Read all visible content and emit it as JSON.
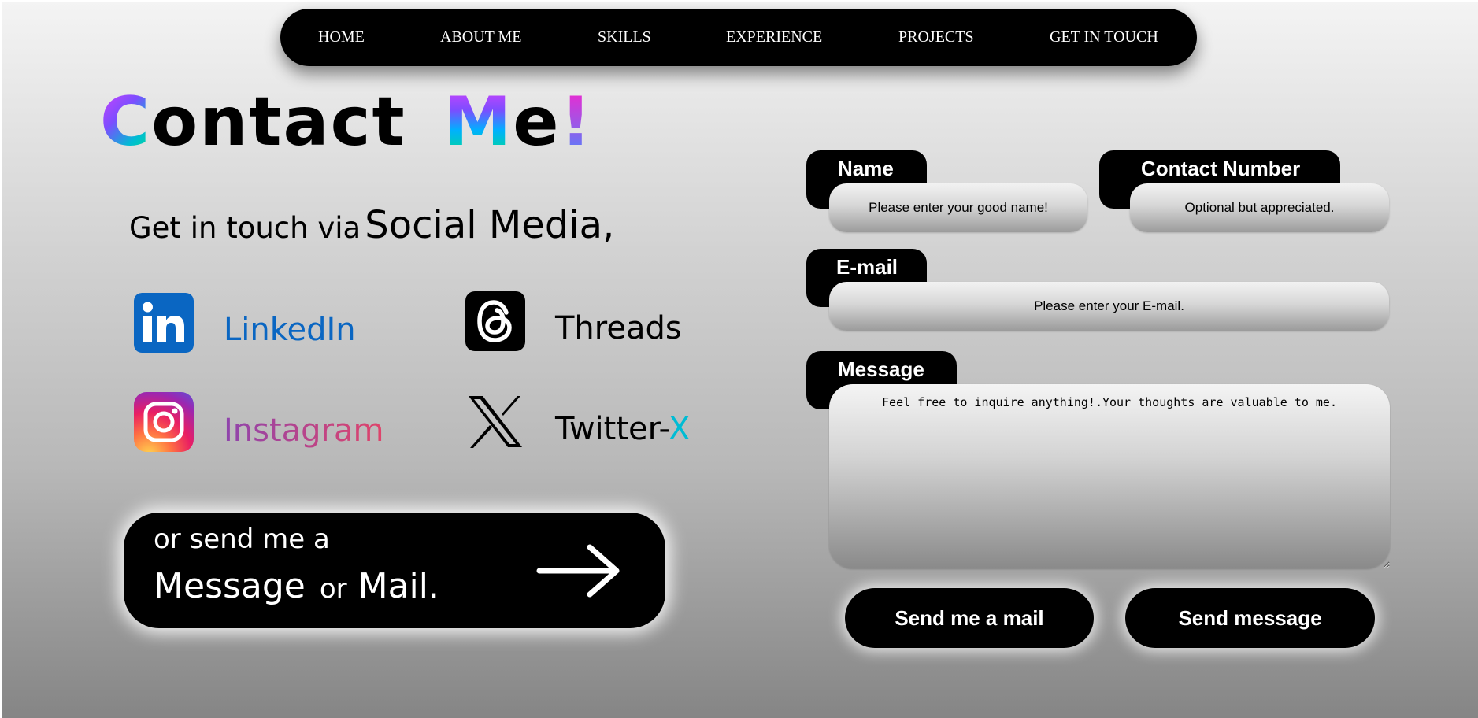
{
  "nav": {
    "items": [
      "HOME",
      "ABOUT ME",
      "SKILLS",
      "EXPERIENCE",
      "PROJECTS",
      "GET IN TOUCH"
    ]
  },
  "heading": {
    "c": "C",
    "ontact": "ontact",
    "m": "M",
    "e": "e",
    "exclaim": "!"
  },
  "social_heading": {
    "prefix": "Get in touch via",
    "emphasis": "Social Media,"
  },
  "socials": {
    "linkedin": {
      "label": "LinkedIn",
      "icon": "linkedin-icon",
      "color": "#0a66c2"
    },
    "threads": {
      "label": "Threads",
      "icon": "threads-icon",
      "color": "#000000"
    },
    "instagram": {
      "label": "Instagram",
      "icon": "instagram-icon",
      "color": "#b34ab8"
    },
    "twitter": {
      "label_main": "Twitter-",
      "label_x": "X",
      "icon": "x-icon",
      "accent": "#00bcd4"
    }
  },
  "send_box": {
    "line1": "or send me a",
    "word1": "Message",
    "or": "or",
    "word2": "Mail.",
    "icon": "arrow-right-icon"
  },
  "form": {
    "name_label": "Name",
    "name_placeholder": "Please enter your good name!",
    "contact_label": "Contact Number",
    "contact_placeholder": "Optional but appreciated.",
    "email_label": "E-mail",
    "email_placeholder": "Please enter your E-mail.",
    "message_label": "Message",
    "message_placeholder": "Feel free to inquire anything!.Your thoughts are valuable to me.",
    "mail_button": "Send me a mail",
    "message_button": "Send message"
  },
  "colors": {
    "nav_bg": "#000000",
    "linkedin_blue": "#0a66c2",
    "x_accent": "#00bcd4"
  }
}
